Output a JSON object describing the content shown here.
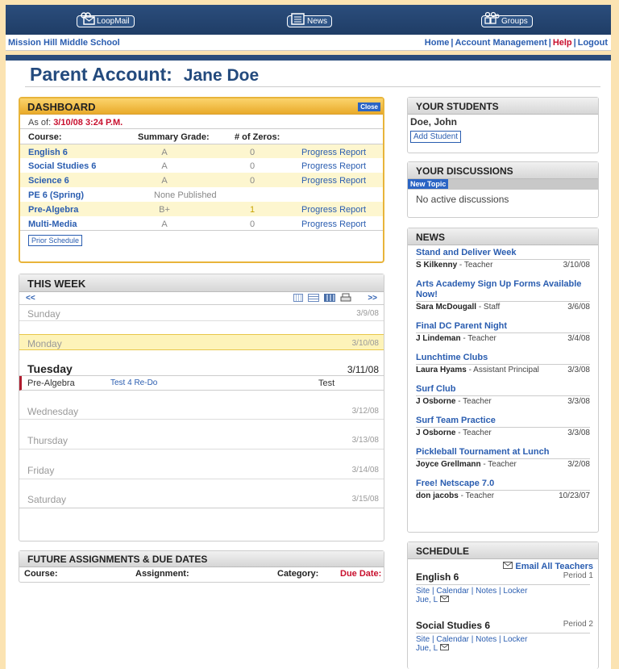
{
  "nav": {
    "loopmail": "LoopMail",
    "news": "News",
    "groups": "Groups"
  },
  "subnav": {
    "school": "Mission Hill Middle School",
    "home": "Home",
    "account": "Account Management",
    "help": "Help",
    "logout": "Logout",
    "sep": "|"
  },
  "page": {
    "title": "Parent Account:",
    "name": "Jane Doe"
  },
  "dashboard": {
    "title": "DASHBOARD",
    "close": "Close",
    "asof_label": "As of:",
    "asof_value": "3/10/08 3:24 P.M.",
    "headers": [
      "Course:",
      "Summary Grade:",
      "# of Zeros:"
    ],
    "rows": [
      {
        "course": "English 6",
        "grade": "A",
        "zeros": "0",
        "link": "Progress Report"
      },
      {
        "course": "Social Studies 6",
        "grade": "A",
        "zeros": "0",
        "link": "Progress Report"
      },
      {
        "course": "Science 6",
        "grade": "A",
        "zeros": "0",
        "link": "Progress Report"
      },
      {
        "course": "PE 6 (Spring)",
        "grade": "None Published",
        "zeros": "",
        "link": ""
      },
      {
        "course": "Pre-Algebra",
        "grade": "B+",
        "zeros": "1",
        "link": "Progress Report"
      },
      {
        "course": "Multi-Media",
        "grade": "A",
        "zeros": "0",
        "link": "Progress Report"
      }
    ],
    "prior": "Prior Schedule"
  },
  "week": {
    "title": "THIS WEEK",
    "prev": "<<",
    "next": ">>",
    "days": [
      {
        "name": "Sunday",
        "date": "3/9/08"
      },
      {
        "name": "Monday",
        "date": "3/10/08"
      },
      {
        "name": "Tuesday",
        "date": "3/11/08"
      },
      {
        "name": "Wednesday",
        "date": "3/12/08"
      },
      {
        "name": "Thursday",
        "date": "3/13/08"
      },
      {
        "name": "Friday",
        "date": "3/14/08"
      },
      {
        "name": "Saturday",
        "date": "3/15/08"
      }
    ],
    "event": {
      "course": "Pre-Algebra",
      "assignment": "Test 4 Re-Do",
      "category": "Test"
    }
  },
  "future": {
    "title": "FUTURE ASSIGNMENTS & DUE DATES",
    "cols": [
      "Course:",
      "Assignment:",
      "Category:",
      "Due Date:"
    ]
  },
  "students": {
    "title": "YOUR STUDENTS",
    "name": "Doe, John",
    "add": "Add Student"
  },
  "discussions": {
    "title": "YOUR DISCUSSIONS",
    "new": "New Topic",
    "empty": "No active discussions"
  },
  "news": {
    "title": "NEWS",
    "items": [
      {
        "title": "Stand and Deliver Week",
        "author": "S Kilkenny",
        "role": "- Teacher",
        "date": "3/10/08"
      },
      {
        "title": "Arts Academy Sign Up Forms Available Now!",
        "author": "Sara McDougall",
        "role": "- Staff",
        "date": "3/6/08"
      },
      {
        "title": "Final DC Parent Night",
        "author": "J Lindeman",
        "role": "- Teacher",
        "date": "3/4/08"
      },
      {
        "title": "Lunchtime Clubs",
        "author": "Laura Hyams",
        "role": "- Assistant Principal",
        "date": "3/3/08"
      },
      {
        "title": "Surf Club",
        "author": "J Osborne",
        "role": "- Teacher",
        "date": "3/3/08"
      },
      {
        "title": "Surf Team Practice",
        "author": "J Osborne",
        "role": "- Teacher",
        "date": "3/3/08"
      },
      {
        "title": "Pickleball Tournament at Lunch",
        "author": "Joyce Grellmann",
        "role": "- Teacher",
        "date": "3/2/08"
      },
      {
        "title": "Free! Netscape 7.0",
        "author": "don jacobs",
        "role": "- Teacher",
        "date": "10/23/07"
      }
    ]
  },
  "schedule": {
    "title": "SCHEDULE",
    "email_all": "Email All Teachers",
    "classes": [
      {
        "course": "English 6",
        "period": "Period 1",
        "site": "Site",
        "calendar": "Calendar",
        "notes": "Notes",
        "locker": "Locker",
        "teacher": "Jue, L"
      },
      {
        "course": "Social Studies 6",
        "period": "Period 2",
        "site": "Site",
        "calendar": "Calendar",
        "notes": "Notes",
        "locker": "Locker",
        "teacher": "Jue, L"
      }
    ]
  }
}
